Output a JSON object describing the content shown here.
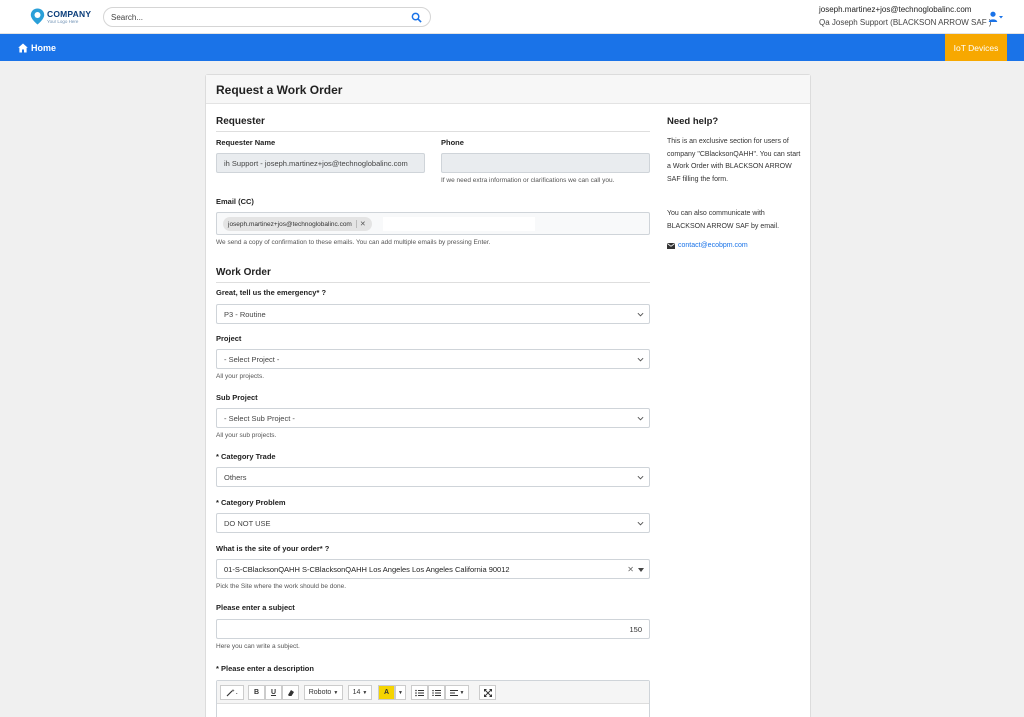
{
  "header": {
    "logo_name": "COMPANY",
    "logo_tagline": "Your Logo Here",
    "search_placeholder": "Search...",
    "user_email": "joseph.martinez+jos@technoglobalinc.com",
    "user_display": "Qa Joseph Support (BLACKSON ARROW SAF )"
  },
  "nav": {
    "home_label": "Home",
    "iot_label": "IoT Devices"
  },
  "colors": {
    "nav_blue": "#1a73e8",
    "iot_orange": "#f7a800"
  },
  "form": {
    "title": "Request a Work Order",
    "requester_section": "Requester",
    "requester_name_label": "Requester Name",
    "requester_name_value": "ih Support  - joseph.martinez+jos@technoglobalinc.com",
    "phone_label": "Phone",
    "phone_value": "",
    "phone_help": "If we need extra information or clarifications we can call you.",
    "email_cc_label": "Email (CC)",
    "email_tag": "joseph.martinez+jos@technoglobalinc.com",
    "email_help": "We send a copy of confirmation to these emails. You can add multiple emails by pressing Enter.",
    "workorder_section": "Work Order",
    "emergency_label": "Great, tell us the emergency* ?",
    "emergency_value": "P3 - Routine",
    "project_label": "Project",
    "project_value": "- Select Project -",
    "project_help": "All your projects.",
    "subproject_label": "Sub Project",
    "subproject_value": "- Select Sub Project -",
    "subproject_help": "All your sub projects.",
    "category_trade_label": "* Category Trade",
    "category_trade_value": "Others",
    "category_problem_label": "* Category Problem",
    "category_problem_value": "DO NOT USE",
    "site_label": "What is the site of your order* ?",
    "site_value": "01-S-CBlacksonQAHH S-CBlacksonQAHH Los Angeles Los Angeles California 90012",
    "site_help": "Pick the Site where the work should be done.",
    "subject_label": "Please enter a subject",
    "subject_counter": "150",
    "subject_help": "Here you can write a subject.",
    "description_label": "* Please enter a description"
  },
  "editor": {
    "font_name": "Roboto",
    "font_size": "14",
    "bold": "B",
    "underline": "U",
    "highlight": "A"
  },
  "help_panel": {
    "title": "Need help?",
    "para1": "This is an exclusive section for users of company \"CBlacksonQAHH\". You can start a Work Order with BLACKSON ARROW SAF filling the form.",
    "para2": "You can also communicate with BLACKSON ARROW SAF by email.",
    "contact_email": "contact@ecobpm.com"
  }
}
